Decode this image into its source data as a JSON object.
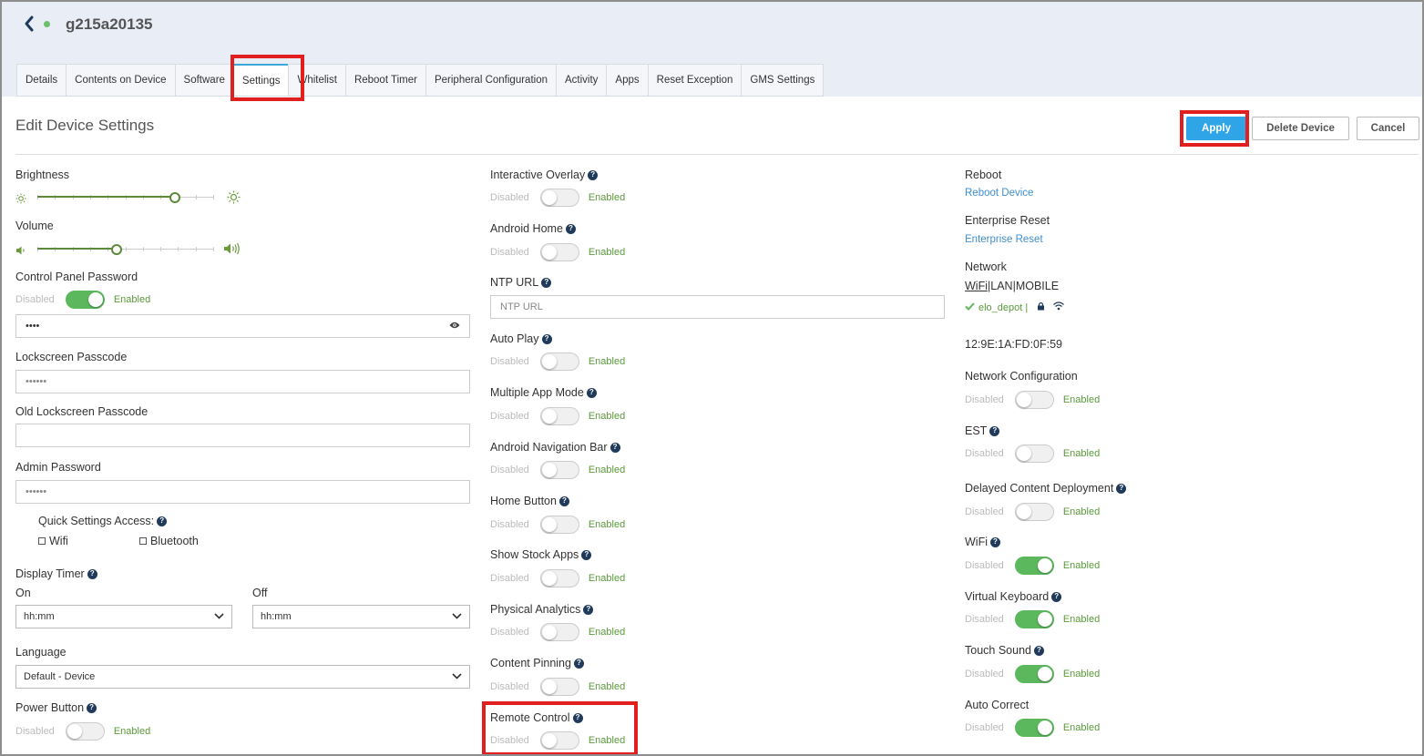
{
  "header": {
    "device_name": "g215a20135"
  },
  "tabs": [
    "Details",
    "Contents on Device",
    "Software",
    "Settings",
    "Whitelist",
    "Reboot Timer",
    "Peripheral Configuration",
    "Activity",
    "Apps",
    "Reset Exception",
    "GMS Settings"
  ],
  "page": {
    "title": "Edit Device Settings"
  },
  "actions": {
    "apply": "Apply",
    "delete": "Delete Device",
    "cancel": "Cancel"
  },
  "toggle_text": {
    "disabled": "Disabled",
    "enabled": "Enabled"
  },
  "left": {
    "brightness": {
      "label": "Brightness",
      "level": 0.78
    },
    "volume": {
      "label": "Volume",
      "level": 0.45
    },
    "control_panel_password": {
      "label": "Control Panel Password",
      "value": "••••",
      "enabled": true
    },
    "lockscreen_passcode": {
      "label": "Lockscreen Passcode",
      "placeholder": "••••••"
    },
    "old_lockscreen_passcode": {
      "label": "Old Lockscreen Passcode",
      "value": ""
    },
    "admin_password": {
      "label": "Admin Password",
      "placeholder": "••••••"
    },
    "quick_settings": {
      "label": "Quick Settings Access:",
      "wifi": "Wifi",
      "bluetooth": "Bluetooth"
    },
    "display_timer": {
      "label": "Display Timer",
      "on_label": "On",
      "off_label": "Off",
      "on_value": "hh:mm",
      "off_value": "hh:mm"
    },
    "language": {
      "label": "Language",
      "value": "Default - Device"
    },
    "power_button": {
      "label": "Power Button",
      "enabled": false
    }
  },
  "middle": {
    "interactive_overlay": {
      "label": "Interactive Overlay",
      "enabled": false
    },
    "android_home": {
      "label": "Android Home",
      "enabled": false
    },
    "ntp_url": {
      "label": "NTP URL",
      "placeholder": "NTP URL"
    },
    "auto_play": {
      "label": "Auto Play",
      "enabled": false
    },
    "multiple_app_mode": {
      "label": "Multiple App Mode",
      "enabled": false
    },
    "android_navigation_bar": {
      "label": "Android Navigation Bar",
      "enabled": false
    },
    "home_button": {
      "label": "Home Button",
      "enabled": false
    },
    "show_stock_apps": {
      "label": "Show Stock Apps",
      "enabled": false
    },
    "physical_analytics": {
      "label": "Physical Analytics",
      "enabled": false
    },
    "content_pinning": {
      "label": "Content Pinning",
      "enabled": false
    },
    "remote_control": {
      "label": "Remote Control",
      "enabled": false
    }
  },
  "right": {
    "reboot": {
      "label": "Reboot",
      "link": "Reboot Device"
    },
    "enterprise_reset": {
      "label": "Enterprise Reset",
      "link": "Enterprise Reset"
    },
    "network": {
      "label": "Network",
      "type_wifi": "WiFi",
      "type_lan": "LAN",
      "type_mobile": "MOBILE",
      "ssid": "elo_depot |",
      "mac": "12:9E:1A:FD:0F:59"
    },
    "network_configuration": {
      "label": "Network Configuration",
      "enabled": false
    },
    "est": {
      "label": "EST",
      "enabled": false
    },
    "delayed_content_deployment": {
      "label": "Delayed Content Deployment",
      "enabled": false
    },
    "wifi": {
      "label": "WiFi",
      "enabled": true
    },
    "virtual_keyboard": {
      "label": "Virtual Keyboard",
      "enabled": true
    },
    "touch_sound": {
      "label": "Touch Sound",
      "enabled": true
    },
    "auto_correct": {
      "label": "Auto Correct",
      "enabled": true
    }
  },
  "colors": {
    "accent": "#2fa4e7",
    "toggle_on": "#5cb85c",
    "highlight": "#e21f1f",
    "link": "#3f8ed0"
  }
}
